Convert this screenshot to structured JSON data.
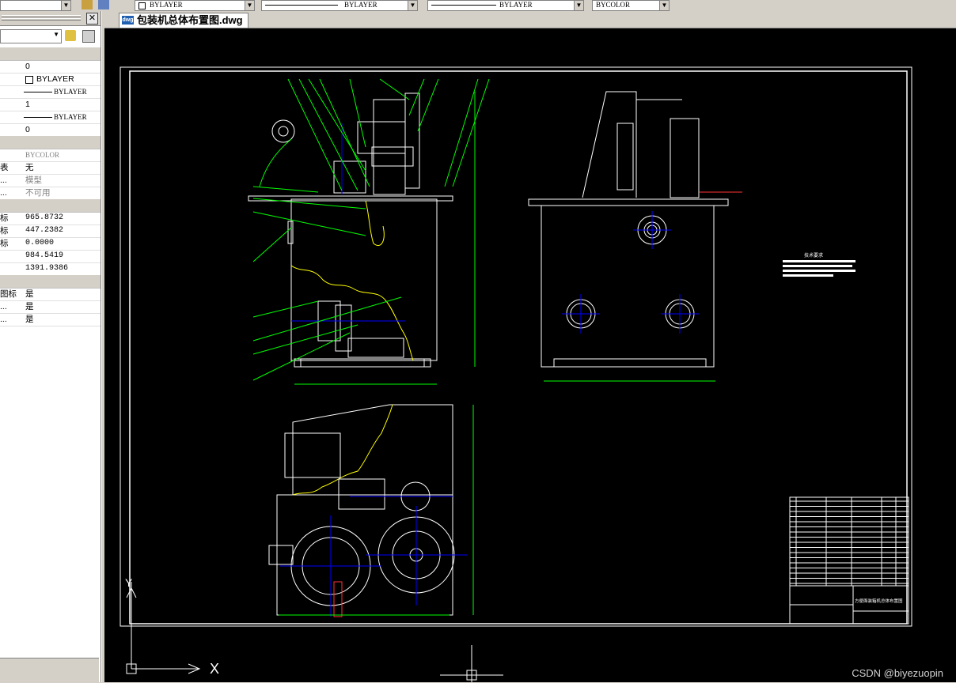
{
  "toolbar": {
    "layer_combo_1": "BYLAYER",
    "linetype_combo": "BYLAYER",
    "lineweight_combo": "BYLAYER",
    "color_combo": "BYCOLOR"
  },
  "properties": {
    "rows": [
      {
        "key": "",
        "value": "",
        "category": true
      },
      {
        "key": "",
        "value": "0"
      },
      {
        "key": "",
        "value": "BYLAYER",
        "swatch": true
      },
      {
        "key": "",
        "value": "BYLAYER",
        "line": true
      },
      {
        "key": "",
        "value": "1"
      },
      {
        "key": "",
        "value": "BYLAYER",
        "line": true
      },
      {
        "key": "",
        "value": "0"
      },
      {
        "key": "",
        "value": "",
        "category": true
      },
      {
        "key": "",
        "value": "BYCOLOR",
        "gray": true
      },
      {
        "key": "表",
        "value": "无"
      },
      {
        "key": "...",
        "value": "模型",
        "gray": true
      },
      {
        "key": "...",
        "value": "不可用",
        "gray": true
      },
      {
        "key": "",
        "value": "",
        "category": true
      },
      {
        "key": "标",
        "value": "965.8732",
        "mono": true
      },
      {
        "key": "标",
        "value": "447.2382",
        "mono": true
      },
      {
        "key": "标",
        "value": "0.0000",
        "mono": true
      },
      {
        "key": "",
        "value": "984.5419",
        "mono": true
      },
      {
        "key": "",
        "value": "1391.9386",
        "mono": true
      },
      {
        "key": "",
        "value": "",
        "category": true
      },
      {
        "key": "图标",
        "value": "是"
      },
      {
        "key": "...",
        "value": "是"
      },
      {
        "key": "...",
        "value": "是"
      }
    ]
  },
  "document": {
    "tab_label": "包装机总体布置图.dwg",
    "tab_icon": "dwg-file-icon"
  },
  "drawing": {
    "notes_title": "技术要求",
    "title_block_name": "方便面装箱机总体布置图",
    "ucs_x_label": "X",
    "ucs_y_label": "Y"
  },
  "watermark": "CSDN @biyezuopin",
  "colors": {
    "canvas_bg": "#000000",
    "drawing_lines": "#ffffff",
    "dimension": "#00ff00",
    "centerline": "#0000ff",
    "section_break": "#ffff00",
    "hatch": "#ff0000"
  }
}
